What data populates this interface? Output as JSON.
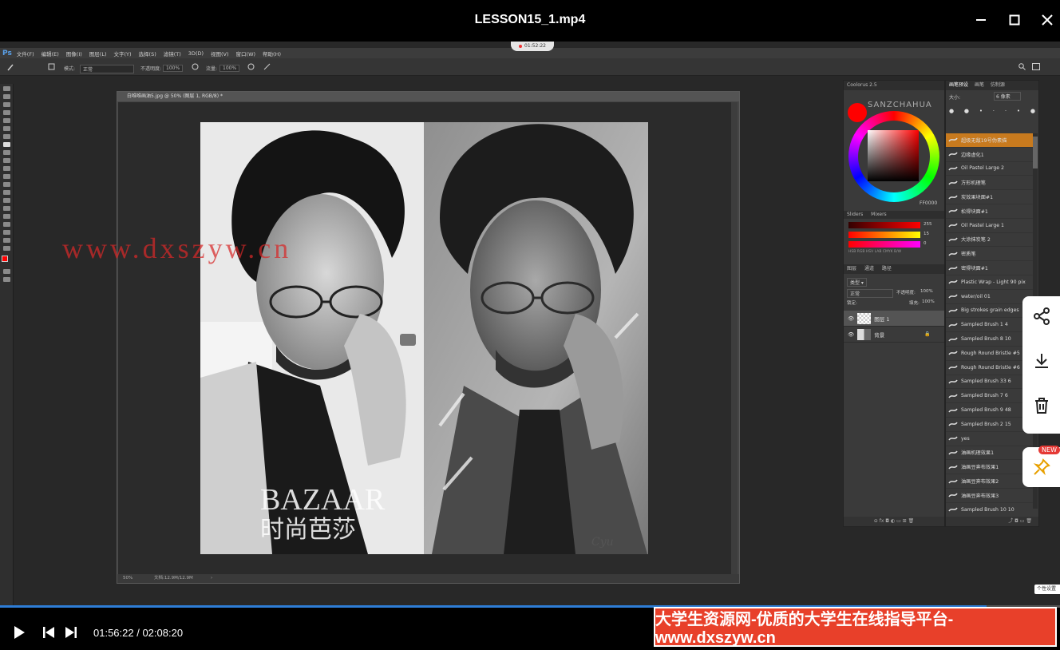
{
  "window": {
    "title": "LESSON15_1.mp4",
    "video_timestamp": "01:52:22"
  },
  "ps": {
    "logo": "Ps",
    "menu": [
      "文件(F)",
      "编辑(E)",
      "图像(I)",
      "图层(L)",
      "文字(Y)",
      "选择(S)",
      "滤镜(T)",
      "3D(D)",
      "视图(V)",
      "窗口(W)",
      "帮助(H)"
    ],
    "options": {
      "mode_label": "模式:",
      "mode_value": "正常",
      "opacity_label": "不透明度:",
      "opacity_value": "100%",
      "flow_label": "流量:",
      "flow_value": "100%"
    },
    "doc": {
      "title": "白唯唯画油5.jpg @ 50% (图层 1, RGB/8) *",
      "zoom": "50%",
      "status": "文档:12.9M/12.9M"
    },
    "watermark": "www.dxszyw.cn",
    "artwork_text": {
      "brand": "BAZAAR",
      "brand_cn": "时尚芭莎",
      "signature": "Cyu"
    },
    "coolorus": {
      "tab": "Coolorus 2.5",
      "brand": "SANZCHAHUA",
      "hex": "FF0000",
      "subtabs": [
        "Sliders",
        "Mixers"
      ],
      "slider_values": [
        "255",
        "15",
        "0"
      ],
      "modes": "HSB RGB HSV LAB CMYK B/W"
    },
    "layers": {
      "tabs": [
        "图层",
        "通道",
        "路径"
      ],
      "filter": "类型",
      "blend": "正常",
      "opacity_label": "不透明度:",
      "opacity": "100%",
      "lock_label": "锁定:",
      "fill_label": "填充:",
      "fill": "100%",
      "items": [
        {
          "name": "图层 1",
          "selected": true
        },
        {
          "name": "背景",
          "selected": false
        }
      ]
    },
    "brushes": {
      "tabs": [
        "画笔预设",
        "画笔",
        "仿制源"
      ],
      "size_label": "大小:",
      "size_value": "6 像素",
      "items": [
        {
          "name": "超级无敌19号伪素描",
          "selected": true
        },
        {
          "name": "边缘虚化1"
        },
        {
          "name": "Oil Pastel Large 2"
        },
        {
          "name": "方形机理笔"
        },
        {
          "name": "炭效果块面#1"
        },
        {
          "name": "松得块面#1"
        },
        {
          "name": "Oil Pastel Large 1"
        },
        {
          "name": "大涂抹炭笔 2"
        },
        {
          "name": "密质笔"
        },
        {
          "name": "密得块面#1"
        },
        {
          "name": "Plastic Wrap - Light 90 pix"
        },
        {
          "name": "water/oil 01"
        },
        {
          "name": "Big strokes grain edges"
        },
        {
          "name": "Sampled Brush 1 4"
        },
        {
          "name": "Sampled Brush 8 10"
        },
        {
          "name": "Rough Round Bristle #5"
        },
        {
          "name": "Rough Round Bristle #6"
        },
        {
          "name": "Sampled Brush 33 6"
        },
        {
          "name": "Sampled Brush 7 6"
        },
        {
          "name": "Sampled Brush 9 48"
        },
        {
          "name": "Sampled Brush 2 15"
        },
        {
          "name": "yes"
        },
        {
          "name": "油画机理效果1"
        },
        {
          "name": "油画豆奔布效果1"
        },
        {
          "name": "油画豆奔布效果2"
        },
        {
          "name": "油画豆奔布效果3"
        },
        {
          "name": "Sampled Brush 10 10"
        }
      ]
    }
  },
  "overlay": {
    "tooltip": "个性设置",
    "new_badge": "NEW"
  },
  "player": {
    "time": "01:56:22 / 02:08:20",
    "progress": 0.9305,
    "banner": "大学生资源网-优质的大学生在线指导平台-www.dxszyw.cn"
  },
  "colors": {
    "accent": "#2e7dd6",
    "banner": "#e8402a",
    "selected_brush": "#c87a1e",
    "foreground": "#ff0000"
  }
}
